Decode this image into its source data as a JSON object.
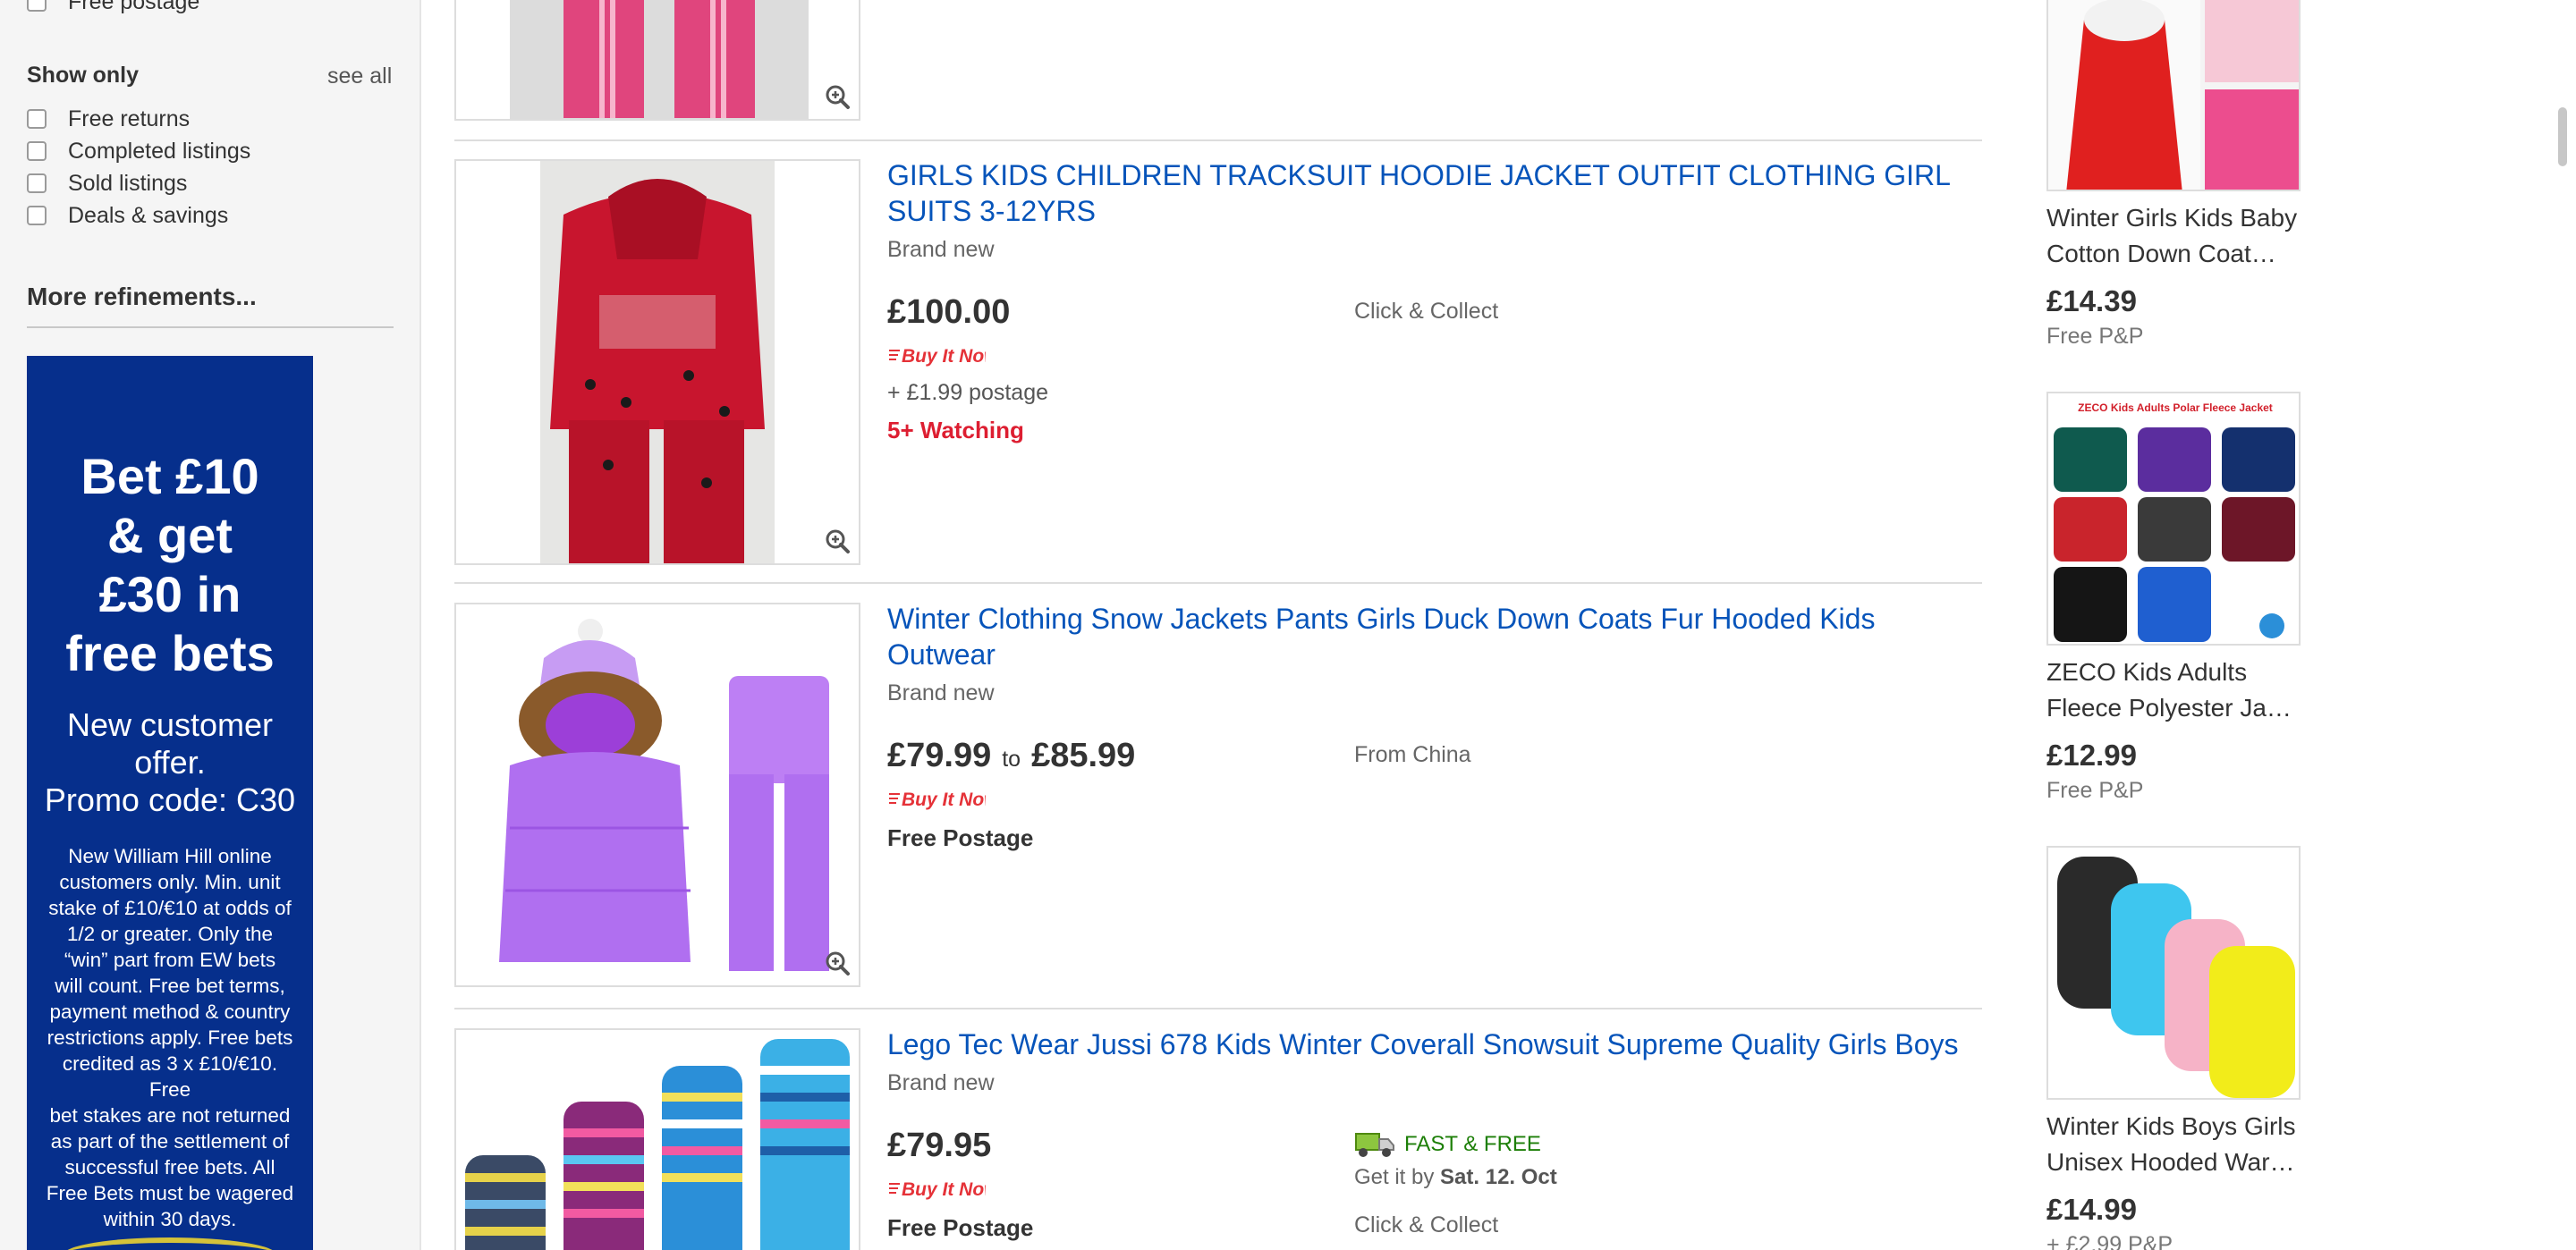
{
  "sidebar": {
    "top_item": "Free postage",
    "show_only": {
      "title": "Show only",
      "see_all": "see all",
      "items": [
        "Free returns",
        "Completed listings",
        "Sold listings",
        "Deals & savings"
      ]
    },
    "more_refinements": "More refinements...",
    "ad": {
      "headline": "Bet £10\n& get\n£30 in\nfree bets",
      "offer": "New customer\noffer.\nPromo code: C30",
      "terms": "New William Hill online\ncustomers only. Min. unit\nstake of £10/€10 at odds of\n1/2 or greater. Only the\n“win” part from EW bets\nwill count. Free bet terms,\npayment method & country\nrestrictions apply. Free bets\ncredited as 3 x £10/€10. Free\nbet stakes are not returned\nas part of the settlement of\nsuccessful free bets. All\nFree Bets must be wagered\nwithin 30 days."
    }
  },
  "listings": [
    {
      "title": "GIRLS KIDS CHILDREN TRACKSUIT HOODIE JACKET OUTFIT CLOTHING GIRL SUITS 3-12YRS",
      "condition": "Brand new",
      "price": "£100.00",
      "buy_it_now": "Buy It Now",
      "postage": "+ £1.99 postage",
      "watching": "5+ Watching",
      "collect": "Click & Collect"
    },
    {
      "title": "Winter Clothing Snow Jackets Pants Girls Duck Down Coats Fur Hooded Kids Outwear",
      "condition": "Brand new",
      "price_from": "£79.99",
      "price_to_word": "to",
      "price_to": "£85.99",
      "buy_it_now": "Buy It Now",
      "postage": "Free Postage",
      "origin": "From China"
    },
    {
      "title": "Lego Tec Wear Jussi 678 Kids Winter Coverall Snowsuit Supreme Quality Girls Boys",
      "condition": "Brand new",
      "price": "£79.95",
      "buy_it_now": "Buy It Now",
      "postage": "Free Postage",
      "fast_free": "FAST & FREE",
      "get_it_by_prefix": "Get it by",
      "get_it_by_date": "Sat. 12. Oct",
      "collect": "Click & Collect"
    }
  ],
  "rail": [
    {
      "title": "Winter Girls Kids Baby Cotton Down Coat…",
      "price": "£14.39",
      "shipping": "Free P&P"
    },
    {
      "image_banner": "ZECO Kids Adults Polar Fleece Jacket",
      "title": "ZECO Kids Adults Fleece Polyester Ja…",
      "price": "£12.99",
      "shipping": "Free P&P"
    },
    {
      "title": "Winter Kids Boys Girls Unisex Hooded War…",
      "price": "£14.99",
      "shipping": "+ £2.99 P&P"
    }
  ],
  "colors": {
    "link": "#0654ba",
    "watching": "#dd1e31",
    "fast_free": "#1d7f08",
    "ad_bg": "#062f8c"
  },
  "icons": [
    "zoom-icon",
    "truck-icon",
    "checkbox"
  ]
}
